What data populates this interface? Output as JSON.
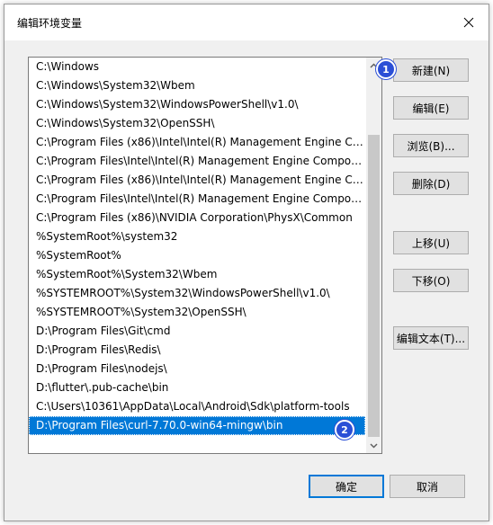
{
  "window": {
    "title": "编辑环境变量"
  },
  "paths": [
    "C:\\Windows",
    "C:\\Windows\\System32\\Wbem",
    "C:\\Windows\\System32\\WindowsPowerShell\\v1.0\\",
    "C:\\Windows\\System32\\OpenSSH\\",
    "C:\\Program Files (x86)\\Intel\\Intel(R) Management Engine Co...",
    "C:\\Program Files\\Intel\\Intel(R) Management Engine Compon...",
    "C:\\Program Files (x86)\\Intel\\Intel(R) Management Engine Co...",
    "C:\\Program Files\\Intel\\Intel(R) Management Engine Compon...",
    "C:\\Program Files (x86)\\NVIDIA Corporation\\PhysX\\Common",
    "%SystemRoot%\\system32",
    "%SystemRoot%",
    "%SystemRoot%\\System32\\Wbem",
    "%SYSTEMROOT%\\System32\\WindowsPowerShell\\v1.0\\",
    "%SYSTEMROOT%\\System32\\OpenSSH\\",
    "D:\\Program Files\\Git\\cmd",
    "D:\\Program Files\\Redis\\",
    "D:\\Program Files\\nodejs\\",
    "D:\\flutter\\.pub-cache\\bin",
    "C:\\Users\\10361\\AppData\\Local\\Android\\Sdk\\platform-tools",
    "D:\\Program Files\\curl-7.70.0-win64-mingw\\bin"
  ],
  "selected_index": 19,
  "buttons": {
    "new": "新建(N)",
    "edit": "编辑(E)",
    "browse": "浏览(B)...",
    "delete": "删除(D)",
    "move_up": "上移(U)",
    "move_down": "下移(O)",
    "edit_text": "编辑文本(T)...",
    "ok": "确定",
    "cancel": "取消"
  },
  "annotations": {
    "badge1": "1",
    "badge2": "2"
  },
  "colors": {
    "selection": "#0078d7",
    "badge": "#2b4fd6"
  }
}
